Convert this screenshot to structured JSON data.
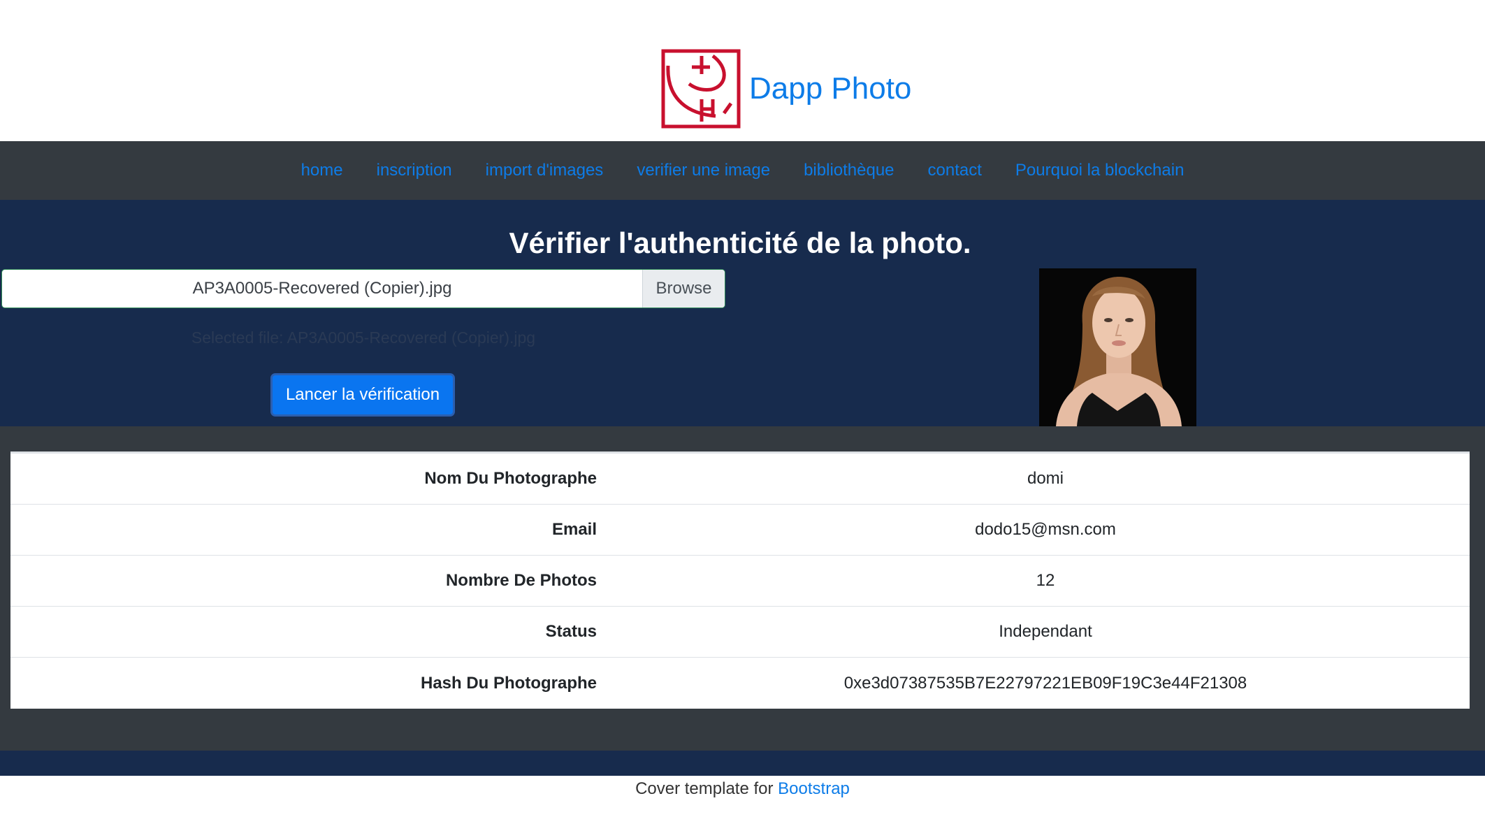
{
  "brand": {
    "name": "Dapp Photo",
    "logo_icon": "camera-logo-icon",
    "logo_color": "#c8102e"
  },
  "nav": {
    "items": [
      {
        "label": "home"
      },
      {
        "label": "inscription"
      },
      {
        "label": "import d'images"
      },
      {
        "label": "verifier une image"
      },
      {
        "label": "bibliothèque"
      },
      {
        "label": "contact"
      },
      {
        "label": "Pourquoi la blockchain"
      }
    ]
  },
  "verify": {
    "title": "Vérifier l'authenticité de la photo.",
    "file_name": "AP3A0005-Recovered (Copier).jpg",
    "browse_label": "Browse",
    "selected_file": "Selected file: AP3A0005-Recovered (Copier).jpg",
    "button_label": "Lancer la vérification"
  },
  "photographer": {
    "rows": [
      {
        "label": "Nom Du Photographe",
        "value": "domi"
      },
      {
        "label": "Email",
        "value": "dodo15@msn.com"
      },
      {
        "label": "Nombre De Photos",
        "value": "12"
      },
      {
        "label": "Status",
        "value": "Independant"
      },
      {
        "label": "Hash Du Photographe",
        "value": "0xe3d07387535B7E22797221EB09F19C3e44F21308"
      }
    ]
  },
  "footer": {
    "text": "Cover template for ",
    "link": "Bootstrap"
  },
  "colors": {
    "accent": "#0d7ce8",
    "nav_bg": "#343a40",
    "hero_bg": "#172b4d",
    "button": "#0a75f0"
  }
}
